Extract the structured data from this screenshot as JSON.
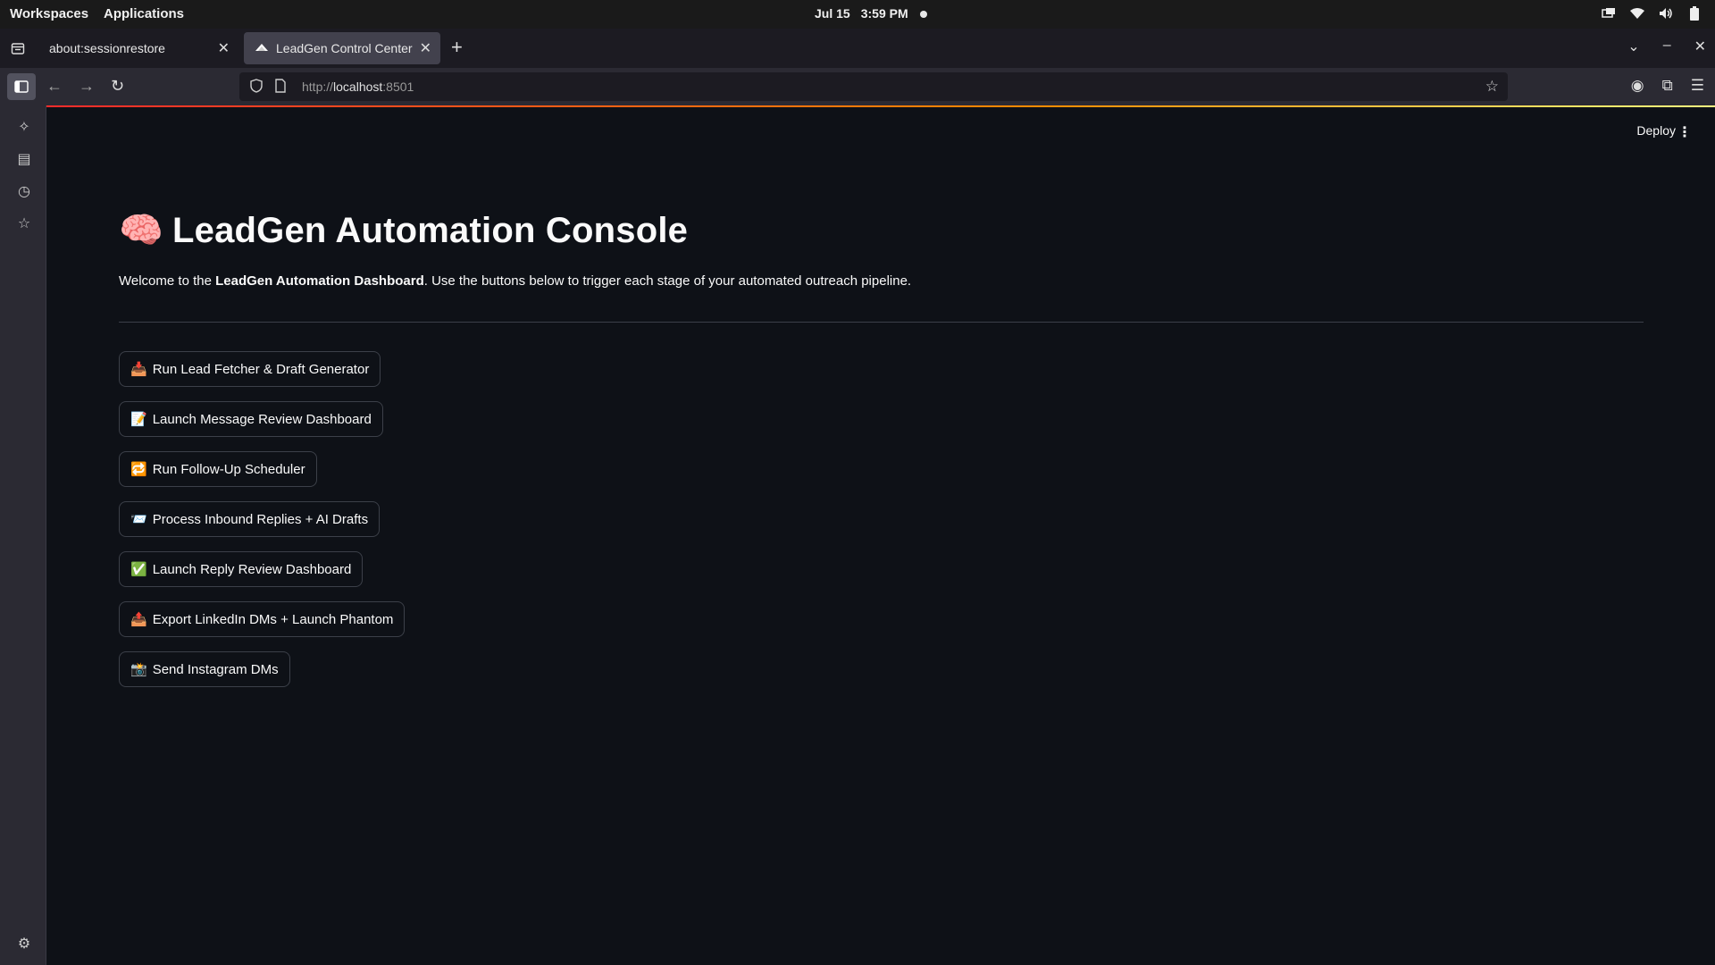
{
  "system_bar": {
    "workspaces": "Workspaces",
    "applications": "Applications",
    "date": "Jul 15",
    "time": "3:59 PM"
  },
  "browser": {
    "tabs": [
      {
        "label": "about:sessionrestore",
        "active": false
      },
      {
        "label": "LeadGen Control Center",
        "active": true
      }
    ],
    "url_prefix": "http://",
    "url_host": "localhost",
    "url_port": ":8501"
  },
  "app": {
    "deploy_label": "Deploy",
    "title_emoji": "🧠",
    "title": "LeadGen Automation Console",
    "welcome_pre": "Welcome to the ",
    "welcome_bold": "LeadGen Automation Dashboard",
    "welcome_post": ". Use the buttons below to trigger each stage of your automated outreach pipeline.",
    "buttons": [
      {
        "emoji": "📥",
        "label": "Run Lead Fetcher & Draft Generator"
      },
      {
        "emoji": "📝",
        "label": "Launch Message Review Dashboard"
      },
      {
        "emoji": "🔁",
        "label": "Run Follow-Up Scheduler"
      },
      {
        "emoji": "📨",
        "label": "Process Inbound Replies + AI Drafts"
      },
      {
        "emoji": "✅",
        "label": "Launch Reply Review Dashboard"
      },
      {
        "emoji": "📤",
        "label": "Export LinkedIn DMs + Launch Phantom"
      },
      {
        "emoji": "📸",
        "label": "Send Instagram DMs"
      }
    ]
  },
  "colors": {
    "app_background": "#0e1117",
    "button_border": "#3c4049",
    "accent_gradient_start": "#ff2b2b",
    "accent_gradient_end": "#fffd80"
  }
}
